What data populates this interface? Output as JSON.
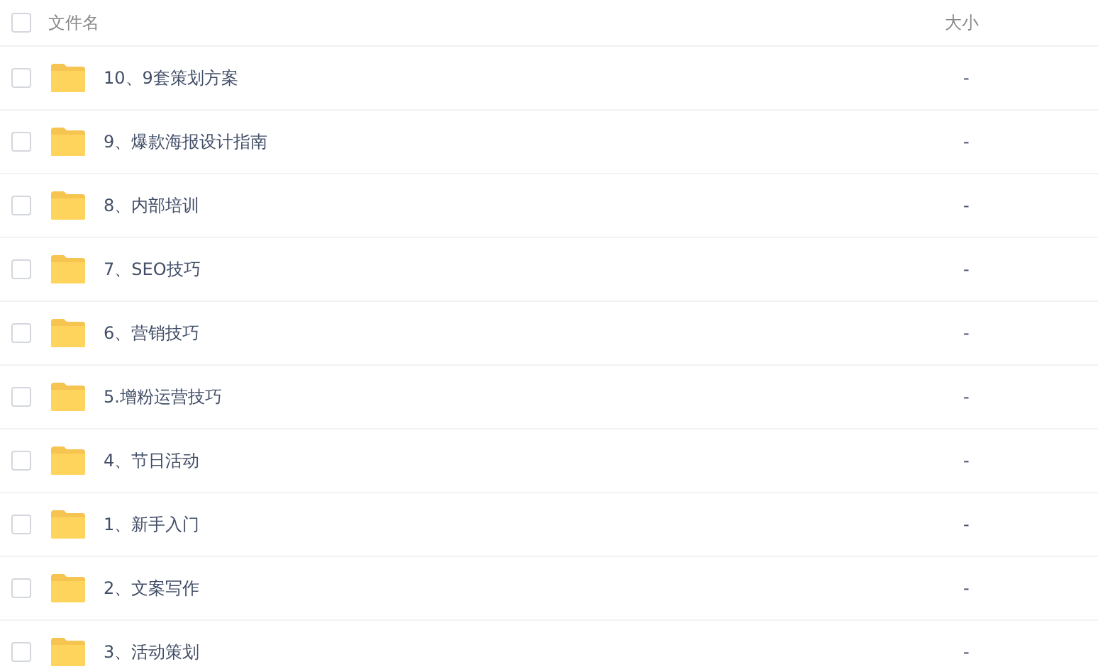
{
  "header": {
    "checked": false,
    "name_column": "文件名",
    "size_column": "大小"
  },
  "rows": [
    {
      "name": "10、9套策划方案",
      "size": "-",
      "checked": false
    },
    {
      "name": "9、爆款海报设计指南",
      "size": "-",
      "checked": false
    },
    {
      "name": "8、内部培训",
      "size": "-",
      "checked": false
    },
    {
      "name": "7、SEO技巧",
      "size": "-",
      "checked": false
    },
    {
      "name": "6、营销技巧",
      "size": "-",
      "checked": false
    },
    {
      "name": "5.增粉运营技巧",
      "size": "-",
      "checked": false
    },
    {
      "name": "4、节日活动",
      "size": "-",
      "checked": false
    },
    {
      "name": "1、新手入门",
      "size": "-",
      "checked": false
    },
    {
      "name": "2、文案写作",
      "size": "-",
      "checked": false
    },
    {
      "name": "3、活动策划",
      "size": "-",
      "checked": false
    }
  ]
}
